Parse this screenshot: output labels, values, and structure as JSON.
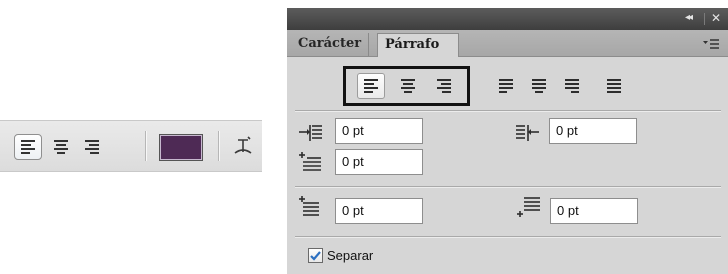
{
  "options_bar": {
    "align_buttons": [
      {
        "icon": "align-left-icon",
        "selected": true
      },
      {
        "icon": "align-center-icon",
        "selected": false
      },
      {
        "icon": "align-right-icon",
        "selected": false
      }
    ],
    "text_color": "#4e2a55",
    "warp_icon": "warp-text-icon"
  },
  "panel": {
    "title_controls": {
      "collapse": "◂◂",
      "close": "✕"
    },
    "tabs": [
      {
        "label": "Carácter",
        "active": false
      },
      {
        "label": "Párrafo",
        "active": true
      }
    ],
    "menu_icon": "panel-menu-icon",
    "alignment_buttons": [
      {
        "icon": "align-left-icon",
        "selected": true
      },
      {
        "icon": "align-center-icon",
        "selected": false
      },
      {
        "icon": "align-right-icon",
        "selected": false
      },
      {
        "icon": "justify-last-left-icon",
        "selected": false
      },
      {
        "icon": "justify-last-center-icon",
        "selected": false
      },
      {
        "icon": "justify-last-right-icon",
        "selected": false
      },
      {
        "icon": "justify-all-icon",
        "selected": false
      }
    ],
    "fields": {
      "indent_left": {
        "icon": "indent-left-icon",
        "value": "0 pt"
      },
      "indent_right": {
        "icon": "indent-right-icon",
        "value": "0 pt"
      },
      "indent_first_line": {
        "icon": "indent-first-line-icon",
        "value": "0 pt"
      },
      "space_before": {
        "icon": "space-before-icon",
        "value": "0 pt"
      },
      "space_after": {
        "icon": "space-after-icon",
        "value": "0 pt"
      }
    },
    "hyphenate": {
      "label": "Separar",
      "checked": true
    }
  },
  "colors": {
    "panel_bg": "#d6d6d6",
    "titlebar": "#4a4a4a",
    "highlight_border": "#111111",
    "checkmark": "#2b6fc1"
  }
}
